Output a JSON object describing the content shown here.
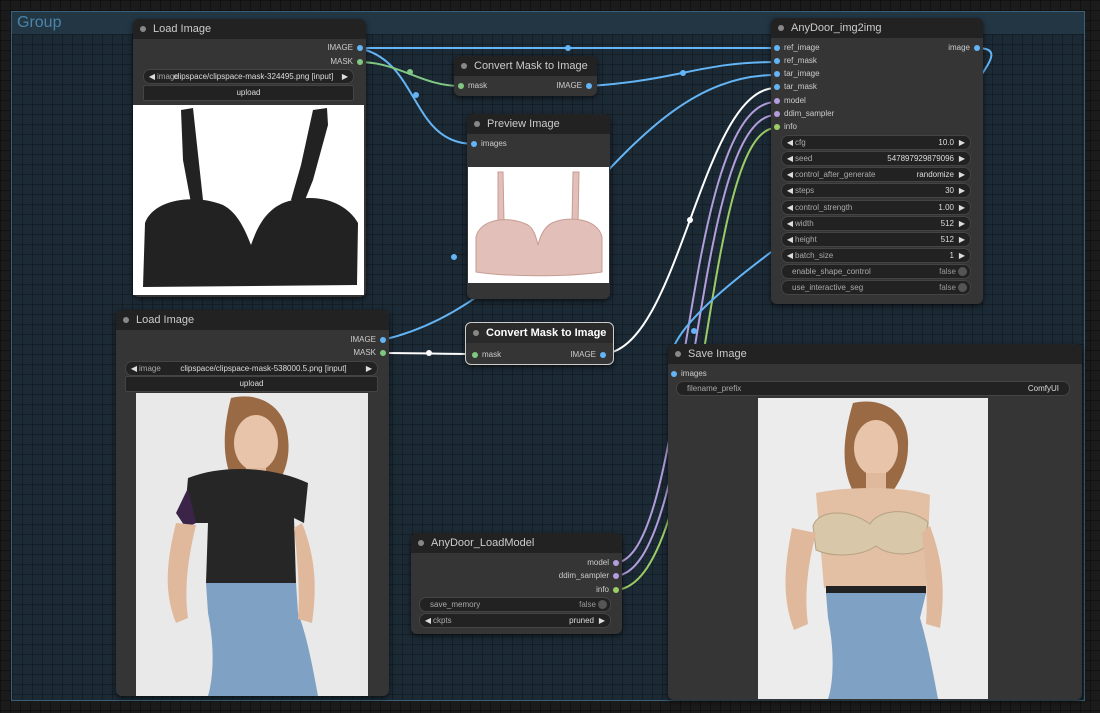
{
  "group": {
    "title": "Group"
  },
  "nodes": {
    "load_image_1": {
      "title": "Load Image",
      "outputs": [
        "IMAGE",
        "MASK"
      ],
      "image_label": "image",
      "image_value": "clipspace/clipspace-mask-324495.png [input]",
      "upload_label": "upload"
    },
    "convert_mask_1": {
      "title": "Convert Mask to Image",
      "input": "mask",
      "output": "IMAGE"
    },
    "preview_image": {
      "title": "Preview Image",
      "input": "images"
    },
    "anydoor": {
      "title": "AnyDoor_img2img",
      "inputs": [
        "ref_image",
        "ref_mask",
        "tar_image",
        "tar_mask",
        "model",
        "ddim_sampler",
        "info"
      ],
      "output": "image",
      "widgets": [
        {
          "label": "cfg",
          "value": "10.0"
        },
        {
          "label": "seed",
          "value": "547897929879096"
        },
        {
          "label": "control_after_generate",
          "value": "randomize"
        },
        {
          "label": "steps",
          "value": "30"
        },
        {
          "label": "control_strength",
          "value": "1.00"
        },
        {
          "label": "width",
          "value": "512"
        },
        {
          "label": "height",
          "value": "512"
        },
        {
          "label": "batch_size",
          "value": "1"
        }
      ],
      "toggles": [
        {
          "label": "enable_shape_control",
          "value": "false"
        },
        {
          "label": "use_interactive_seg",
          "value": "false"
        }
      ]
    },
    "load_image_2": {
      "title": "Load Image",
      "outputs": [
        "IMAGE",
        "MASK"
      ],
      "image_label": "image",
      "image_value": "clipspace/clipspace-mask-538000.5.png [input]",
      "upload_label": "upload"
    },
    "convert_mask_2": {
      "title": "Convert Mask to Image",
      "input": "mask",
      "output": "IMAGE"
    },
    "save_image": {
      "title": "Save Image",
      "input": "images",
      "widget_label": "filename_prefix",
      "widget_value": "ComfyUI"
    },
    "load_model": {
      "title": "AnyDoor_LoadModel",
      "outputs": [
        "model",
        "ddim_sampler",
        "info"
      ],
      "toggle_label": "save_memory",
      "toggle_value": "false",
      "combo_label": "ckpts",
      "combo_value": "pruned"
    }
  },
  "colors": {
    "image_slot": "#64b5f6",
    "mask_slot": "#81c784",
    "model_slot": "#b39ddb",
    "info_slot": "#9ccc65",
    "group_border": "#3b5f78"
  },
  "icons": [
    "left-arrow-icon",
    "right-arrow-icon",
    "node-dot-icon",
    "toggle-knob-icon"
  ]
}
